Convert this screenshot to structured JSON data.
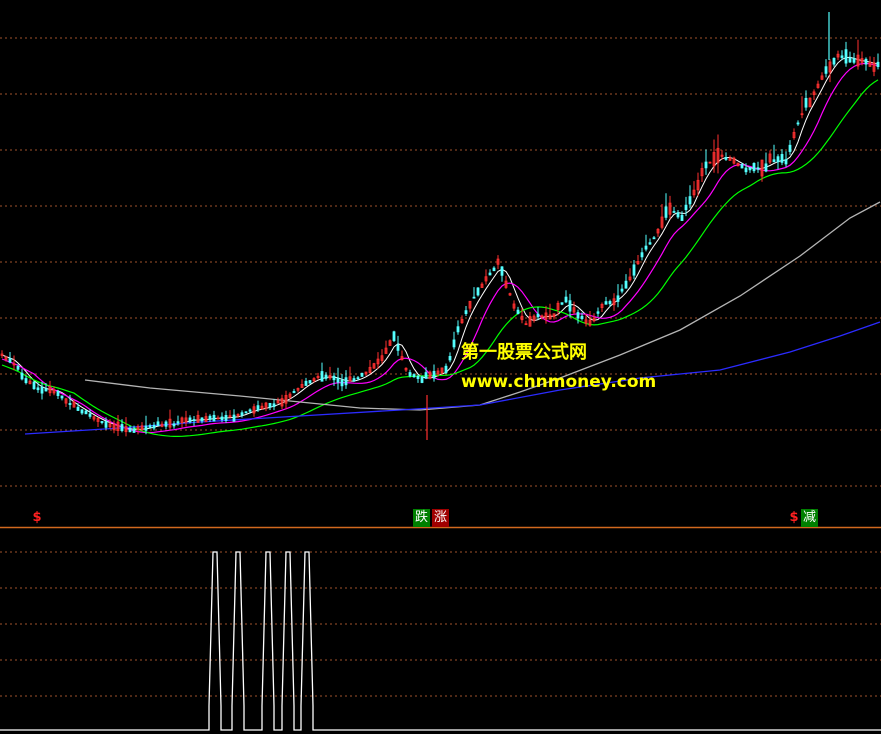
{
  "watermark": {
    "line1": "第一股票公式网",
    "line2": "www.chnmoney.com"
  },
  "signals": {
    "s1": "$",
    "fall": "跌",
    "rise": "涨",
    "s2": "$",
    "reduce": "减"
  },
  "colors": {
    "background": "#000000",
    "grid": "#a0522d",
    "divider": "#d2691e",
    "up_candle": "#ff3030",
    "down_candle": "#54ffff",
    "ma_short": "#ffffff",
    "ma_mid": "#ff00ff",
    "ma_long": "#00ff00",
    "ma_60": "#b4b4b4",
    "ma_120": "#2b2bff",
    "indicator": "#ffffff",
    "fall_box": "#008000",
    "rise_box": "#a00000",
    "reduce_box": "#008000"
  },
  "chart_data": [
    {
      "type": "candlestick",
      "title": "",
      "grid": true,
      "series": [
        {
          "name": "",
          "kind": "ma",
          "color_key": "ma_short"
        },
        {
          "name": "",
          "kind": "ma",
          "color_key": "ma_mid"
        },
        {
          "name": "",
          "kind": "ma",
          "color_key": "ma_long"
        },
        {
          "name": "",
          "kind": "ma",
          "color_key": "ma_60"
        },
        {
          "name": "",
          "kind": "ma",
          "color_key": "ma_120"
        }
      ],
      "close_trend": [
        355,
        365,
        382,
        390,
        390,
        402,
        410,
        418,
        424,
        428,
        430,
        428,
        424,
        425,
        420,
        420,
        418,
        418,
        416,
        410,
        408,
        403,
        396,
        385,
        378,
        376,
        382,
        380,
        372,
        360,
        335,
        372,
        380,
        375,
        370,
        325,
        300,
        280,
        262,
        300,
        325,
        315,
        318,
        300,
        312,
        325,
        305,
        298,
        280,
        252,
        236,
        208,
        218,
        188,
        164,
        155,
        162,
        170,
        168,
        160,
        160,
        118,
        96,
        70,
        55,
        60,
        62,
        66
      ]
    },
    {
      "type": "line",
      "title": "",
      "grid": true,
      "spikes": [
        1,
        1,
        1,
        1,
        1
      ],
      "baseline": 0
    }
  ]
}
